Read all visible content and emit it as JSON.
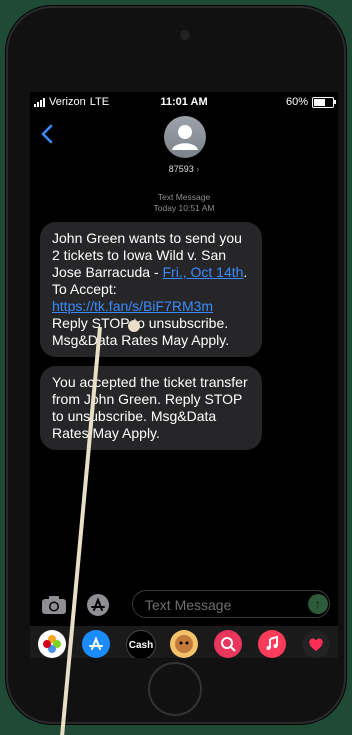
{
  "status_bar": {
    "carrier": "Verizon",
    "network": "LTE",
    "time": "11:01 AM",
    "battery": "60%"
  },
  "header": {
    "contact_number": "87593",
    "chevron": "›"
  },
  "thread": {
    "meta_type": "Text Message",
    "meta_time": "Today 10:51 AM",
    "messages": [
      {
        "name": "John Green",
        "text_before": " wants to send you 2 tickets to Iowa Wild v. San Jose Barracuda - ",
        "date": "Fri., Oct 14th",
        "text_after_date": ". To Accept: ",
        "link": "https://tk.fan/s/BiF7RM3m",
        "footer": " Reply STOP to unsubscribe. Msg&Data Rates May Apply."
      },
      {
        "text_before": "You accepted the ticket transfer from ",
        "name": "John Green",
        "footer": ". Reply STOP to unsubscribe. Msg&Data Rates May Apply."
      }
    ]
  },
  "composer": {
    "placeholder": "Text Message",
    "send_icon": "↑"
  },
  "app_drawer": [
    {
      "name": "photos-app-icon",
      "label": ""
    },
    {
      "name": "app-store-icon",
      "label": ""
    },
    {
      "name": "apple-cash-icon",
      "label": "Cash"
    },
    {
      "name": "memoji-icon",
      "label": ""
    },
    {
      "name": "search-images-icon",
      "label": ""
    },
    {
      "name": "music-icon",
      "label": ""
    },
    {
      "name": "digital-touch-icon",
      "label": ""
    }
  ],
  "colors": {
    "background": "#1f4a35",
    "bubble": "#262628",
    "link": "#3a8bff",
    "status_text": "#8e8e93"
  }
}
